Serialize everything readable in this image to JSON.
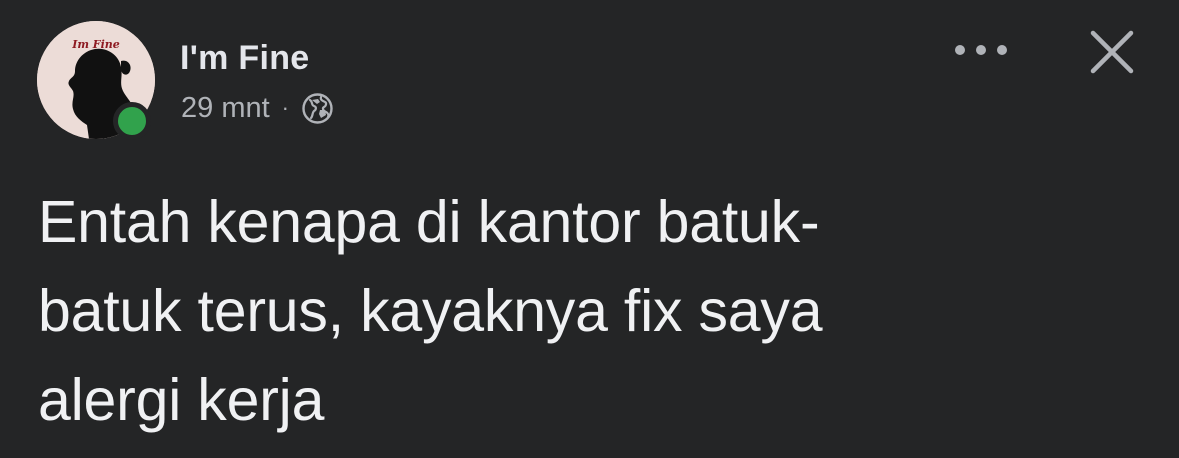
{
  "post": {
    "author_name": "I'm Fine",
    "avatar_badge_text": "Im Fine",
    "time_ago": "29 mnt",
    "separator": "·",
    "audience_icon": "globe-icon",
    "more_icon": "more-options-icon",
    "close_icon": "close-icon",
    "online_status_color": "#31a24c",
    "text_lines": [
      "Entah kenapa di kantor batuk-",
      "batuk terus, kayaknya fix saya",
      "alergi kerja"
    ]
  },
  "colors": {
    "background": "#242526",
    "primary_text": "#e4e6eb",
    "secondary_text": "#b0b3b8"
  }
}
